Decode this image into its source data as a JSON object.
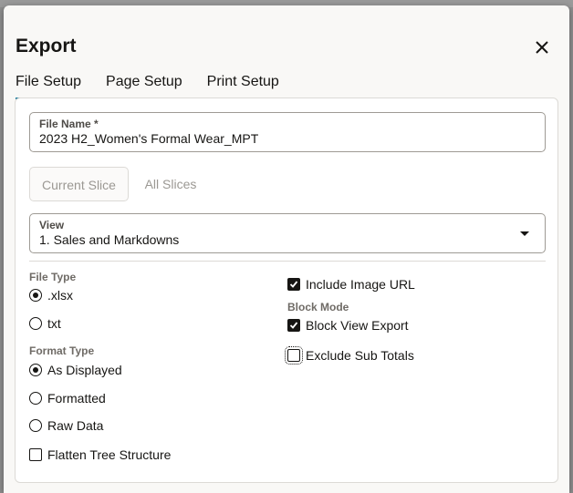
{
  "dialog": {
    "title": "Export",
    "close_icon": "close-icon"
  },
  "tabs": [
    {
      "label": "File Setup",
      "active": true
    },
    {
      "label": "Page Setup",
      "active": false
    },
    {
      "label": "Print Setup",
      "active": false
    }
  ],
  "file_name": {
    "label": "File Name *",
    "value": "2023 H2_Women's Formal Wear_MPT"
  },
  "slices": {
    "current_label": "Current Slice",
    "all_label": "All Slices"
  },
  "view": {
    "label": "View",
    "value": "1. Sales and Markdowns",
    "icon": "chevron-down-icon"
  },
  "file_type": {
    "label": "File Type",
    "options": [
      {
        "label": ".xlsx",
        "selected": true
      },
      {
        "label": "txt",
        "selected": false
      }
    ]
  },
  "format_type": {
    "label": "Format Type",
    "options": [
      {
        "label": "As Displayed",
        "selected": true
      },
      {
        "label": "Formatted",
        "selected": false
      },
      {
        "label": "Raw Data",
        "selected": false
      }
    ]
  },
  "flatten": {
    "label": "Flatten Tree Structure",
    "checked": false
  },
  "include_image_url": {
    "label": "Include Image URL",
    "checked": true
  },
  "block_mode": {
    "label": "Block Mode",
    "block_view_export": {
      "label": "Block View Export",
      "checked": true
    },
    "exclude_sub_totals": {
      "label": "Exclude Sub Totals",
      "checked": false
    }
  },
  "colors": {
    "accent": "#227e9e",
    "overlay": "#8e8e8e",
    "dialog_bg": "#f9f8f6"
  }
}
